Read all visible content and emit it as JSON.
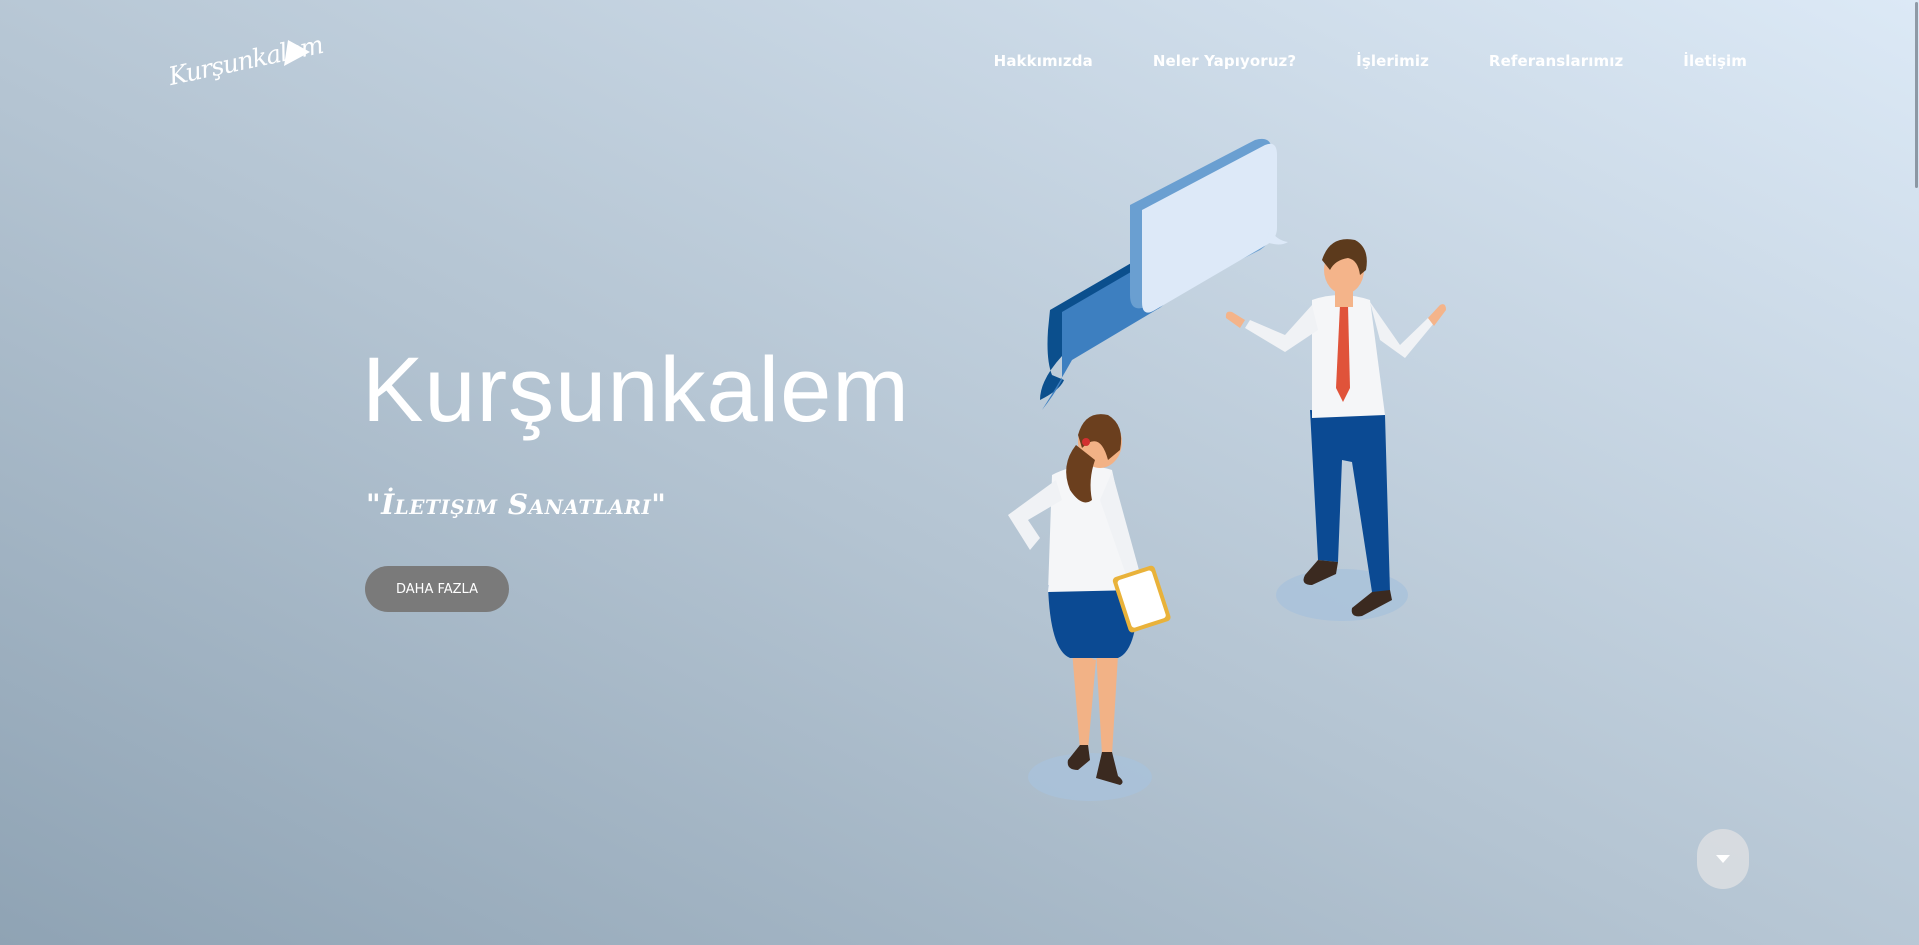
{
  "brand": {
    "logo_text": "Kurşunkalem"
  },
  "nav": {
    "items": [
      {
        "label": "Hakkımızda"
      },
      {
        "label": "Neler Yapıyoruz?"
      },
      {
        "label": "İşlerimiz"
      },
      {
        "label": "Referanslarımız"
      },
      {
        "label": "İletişim"
      }
    ]
  },
  "hero": {
    "title": "Kurşunkalem",
    "subtitle": "\"İletişim Sanatları\"",
    "button_label": "DAHA FAZLA"
  },
  "icons": {
    "scroll_down": "caret-down-icon",
    "logo_mark": "paper-plane-icon"
  },
  "colors": {
    "bg_start": "#8fa3b4",
    "bg_end": "#dce9f6",
    "button": "#7a7a7a",
    "text": "#ffffff"
  }
}
